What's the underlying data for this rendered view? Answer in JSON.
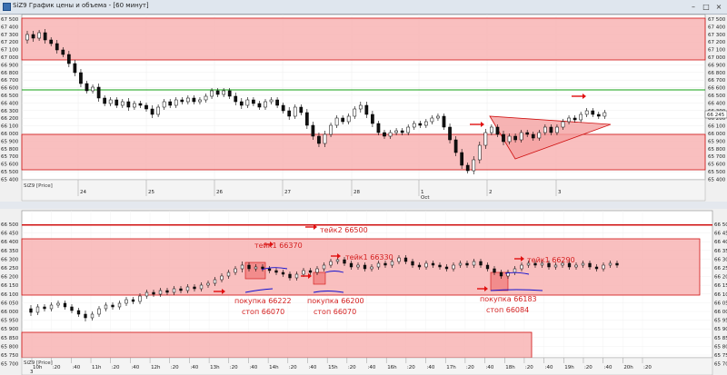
{
  "window": {
    "title": "SiZ9 График цены и объема - [60 минут]",
    "minimize": "–",
    "maximize": "□",
    "close": "×"
  },
  "colors": {
    "zone_fill": "#f8b4b4",
    "zone_line": "#d01010",
    "green_line": "#10a010",
    "blue_line": "#1010d0",
    "arrow": "#e01010",
    "triangle_fill": "#f4a0a0"
  },
  "top_chart": {
    "instrument_label": "SiZ9 [Price]",
    "price_ticks": [
      "67 500",
      "67 400",
      "67 300",
      "67 200",
      "67 100",
      "67 000",
      "66 900",
      "66 800",
      "66 700",
      "66 600",
      "66 500",
      "66 400",
      "66 300",
      "66 200",
      "66 100",
      "66 000",
      "65 900",
      "65 800",
      "65 700",
      "65 600",
      "65 500",
      "65 400"
    ],
    "right_ticks": [
      "67 500",
      "67 400",
      "67 300",
      "67 200",
      "67 100",
      "67 000",
      "66 900",
      "66 800",
      "66 700",
      "66 600",
      "66 500",
      "66 400",
      "66 300",
      "66 200",
      "66 100",
      "66 000",
      "65 900",
      "65 800",
      "65 700",
      "65 600",
      "65 500",
      "65 400"
    ],
    "last_price_label": "66 245",
    "date_labels": [
      "24",
      "25",
      "26",
      "27",
      "28",
      "1",
      "2",
      "3"
    ],
    "month_label": "Oct"
  },
  "bottom_chart": {
    "instrument_label": "SiZ9 [Price]",
    "price_ticks": [
      "66 500",
      "66 450",
      "66 400",
      "66 350",
      "66 300",
      "66 250",
      "66 200",
      "66 150",
      "66 100",
      "66 050",
      "66 000",
      "65 950",
      "65 900",
      "65 850",
      "65 800",
      "65 750",
      "65 700"
    ],
    "time_labels": [
      "10h",
      ":20",
      ":40",
      "11h",
      ":20",
      ":40",
      "12h",
      ":20",
      ":40",
      "13h",
      ":20",
      ":40",
      "14h",
      ":20",
      ":40",
      "15h",
      ":20",
      ":40",
      "16h",
      ":20",
      ":40",
      "17h",
      ":20",
      ":40",
      "18h",
      ":20",
      ":40",
      "19h",
      ":20",
      ":40",
      "20h",
      ":20"
    ],
    "date_label": "3",
    "annotations": {
      "take2": "тейк2 66500",
      "take1_a": "тейк1 66370",
      "take1_b": "тейк1 66330",
      "take1_c": "тейк1 66290",
      "buy_a": "покупка 66222",
      "stop_a": "стоп 66070",
      "buy_b": "покупка 66200",
      "stop_b": "стоп 66070",
      "buy_c": "покупка 66183",
      "stop_c": "стоп 66084"
    }
  }
}
